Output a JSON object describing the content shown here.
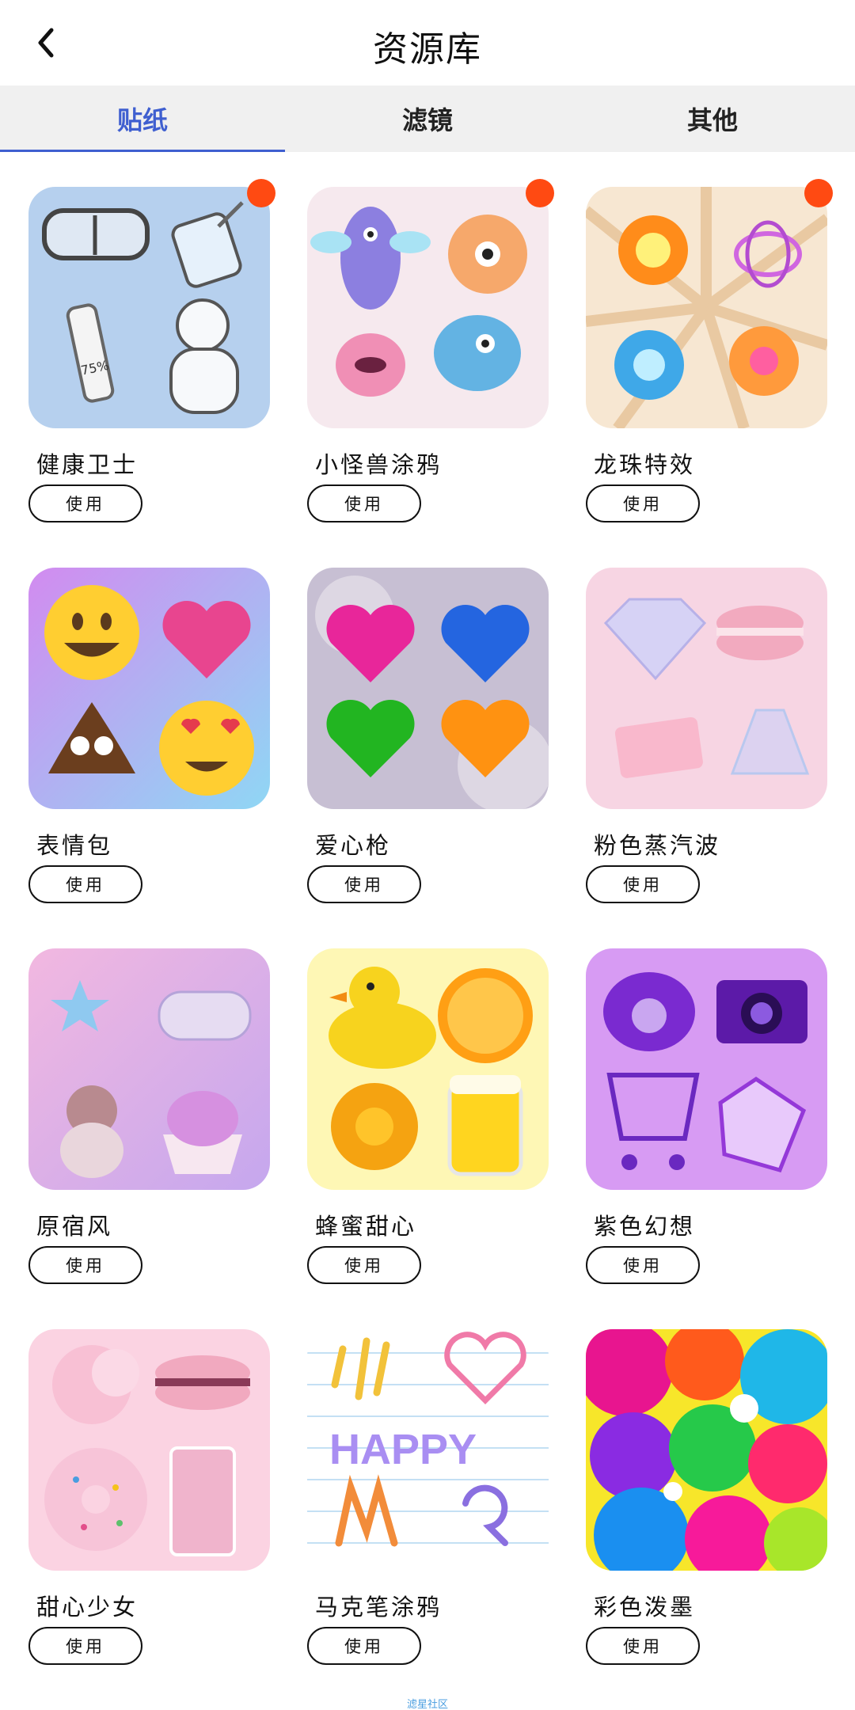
{
  "header": {
    "title": "资源库",
    "back_icon": "chevron-left-icon"
  },
  "tabs": [
    {
      "label": "贴纸",
      "active": true
    },
    {
      "label": "滤镜",
      "active": false
    },
    {
      "label": "其他",
      "active": false
    }
  ],
  "packs": [
    {
      "name": "健康卫士",
      "use_label": "使用",
      "is_new": true
    },
    {
      "name": "小怪兽涂鸦",
      "use_label": "使用",
      "is_new": true
    },
    {
      "name": "龙珠特效",
      "use_label": "使用",
      "is_new": true
    },
    {
      "name": "表情包",
      "use_label": "使用",
      "is_new": false
    },
    {
      "name": "爱心枪",
      "use_label": "使用",
      "is_new": false
    },
    {
      "name": "粉色蒸汽波",
      "use_label": "使用",
      "is_new": false
    },
    {
      "name": "原宿风",
      "use_label": "使用",
      "is_new": false
    },
    {
      "name": "蜂蜜甜心",
      "use_label": "使用",
      "is_new": false
    },
    {
      "name": "紫色幻想",
      "use_label": "使用",
      "is_new": false
    },
    {
      "name": "甜心少女",
      "use_label": "使用",
      "is_new": false
    },
    {
      "name": "马克笔涂鸦",
      "use_label": "使用",
      "is_new": false
    },
    {
      "name": "彩色泼墨",
      "use_label": "使用",
      "is_new": false
    }
  ],
  "accent_color": "#3f5fd0",
  "badge_color": "#ff4a12",
  "footer": {
    "watermark": "滤星社区"
  }
}
